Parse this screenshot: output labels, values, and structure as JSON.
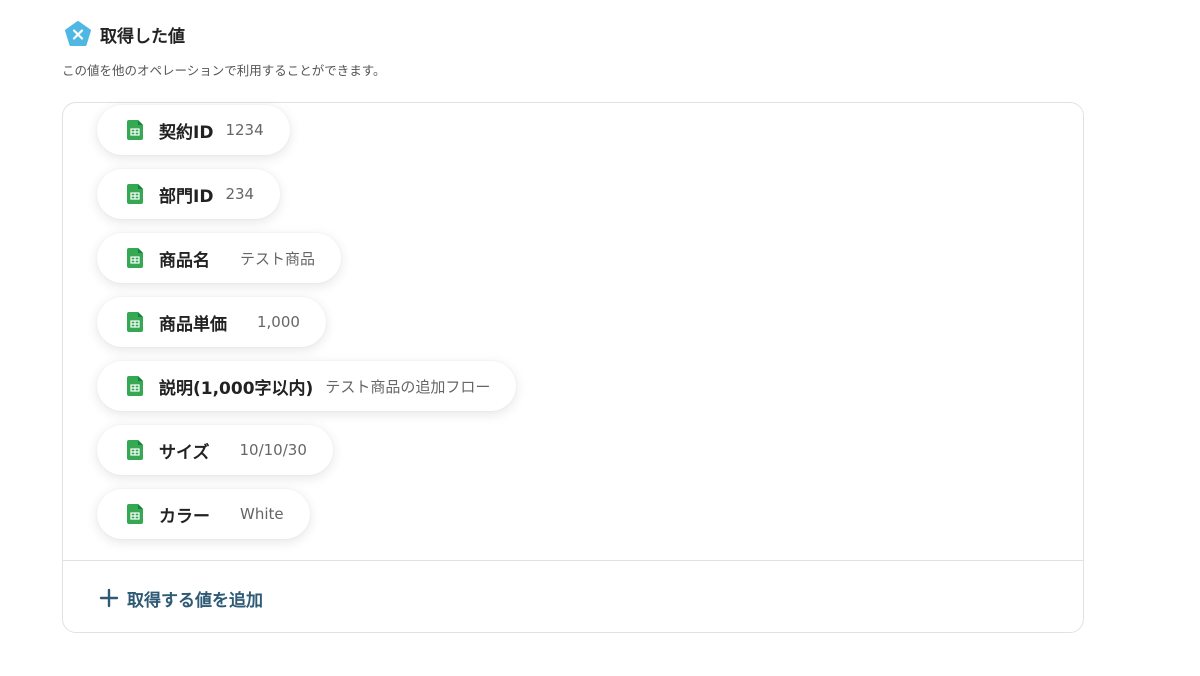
{
  "header": {
    "title": "取得した値",
    "icon": "yoom-pentagon-icon",
    "icon_color": "#4fb7e3",
    "description": "この値を他のオペレーションで利用することができます。"
  },
  "values": [
    {
      "label": "契約ID",
      "value": "1234",
      "icon": "google-sheets-icon"
    },
    {
      "label": "部門ID",
      "value": "234",
      "icon": "google-sheets-icon"
    },
    {
      "label": "商品名",
      "value": "テスト商品",
      "icon": "google-sheets-icon"
    },
    {
      "label": "商品単価",
      "value": "1,000",
      "icon": "google-sheets-icon"
    },
    {
      "label": "説明(1,000字以内)",
      "value": "テスト商品の追加フロー",
      "icon": "google-sheets-icon"
    },
    {
      "label": "サイズ",
      "value": "10/10/30",
      "icon": "google-sheets-icon"
    },
    {
      "label": "カラー",
      "value": "White",
      "icon": "google-sheets-icon"
    }
  ],
  "add_button": {
    "label": "取得する値を追加",
    "icon": "plus-icon",
    "color": "#2e5a75"
  },
  "colors": {
    "sheets_green": "#34a853",
    "border": "#e2e2e2"
  }
}
